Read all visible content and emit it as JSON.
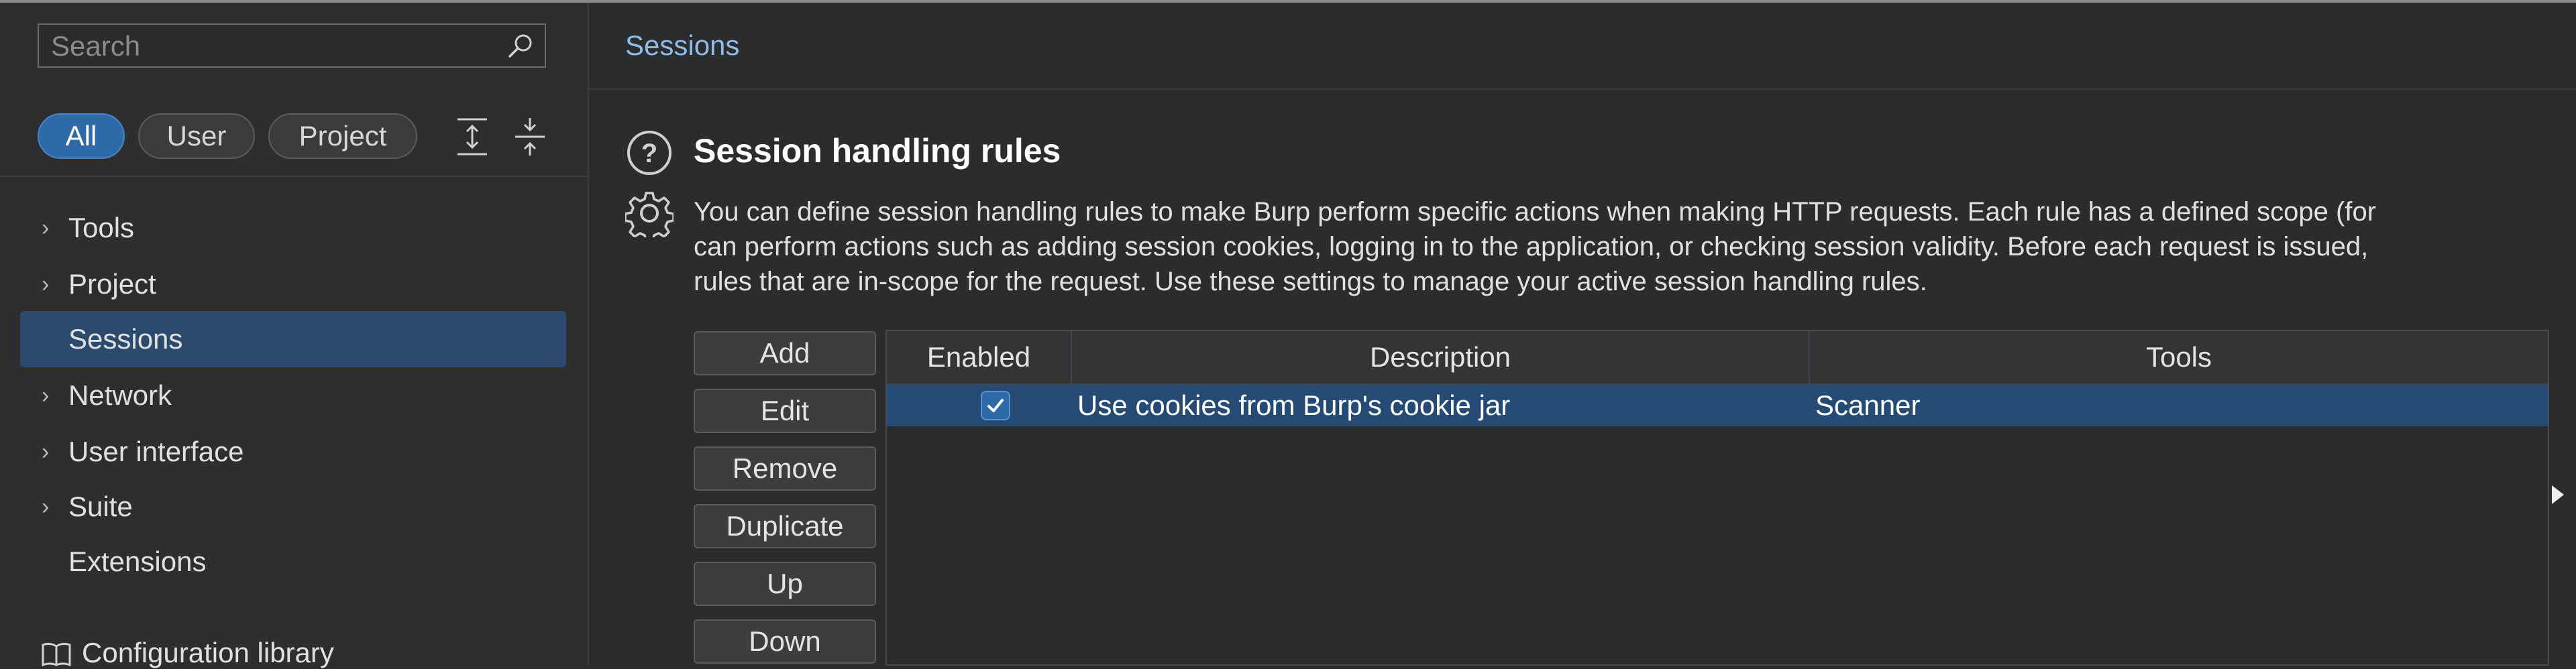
{
  "sidebar": {
    "search_placeholder": "Search",
    "filters": [
      "All",
      "User",
      "Project"
    ],
    "nav": [
      {
        "label": "Tools",
        "has_chevron": true
      },
      {
        "label": "Project",
        "has_chevron": true
      },
      {
        "label": "Sessions",
        "has_chevron": false,
        "selected": true
      },
      {
        "label": "Network",
        "has_chevron": true
      },
      {
        "label": "User interface",
        "has_chevron": true
      },
      {
        "label": "Suite",
        "has_chevron": true
      },
      {
        "label": "Extensions",
        "has_chevron": false
      }
    ],
    "config_library": "Configuration library"
  },
  "main": {
    "breadcrumb": "Sessions",
    "section_title": "Session handling rules",
    "description": [
      "You can define session handling rules to make Burp perform specific actions when making HTTP requests. Each rule has a defined scope (for",
      "can perform actions such as adding session cookies, logging in to the application, or checking session validity. Before each request is issued,",
      "rules that are in-scope for the request. Use these settings to manage your active session handling rules."
    ],
    "buttons": [
      "Add",
      "Edit",
      "Remove",
      "Duplicate",
      "Up",
      "Down"
    ],
    "table": {
      "columns": [
        "Enabled",
        "Description",
        "Tools"
      ],
      "rows": [
        {
          "enabled": true,
          "description": "Use cookies from Burp's cookie jar",
          "tools": "Scanner"
        }
      ]
    }
  },
  "colors": {
    "accent": "#2f6aa8",
    "selected_row": "#254a73",
    "breadcrumb": "#8fbde8"
  }
}
